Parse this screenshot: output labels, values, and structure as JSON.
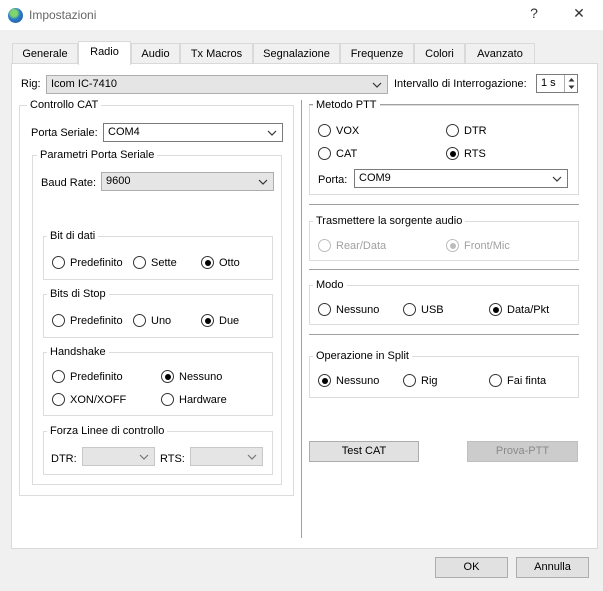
{
  "window": {
    "title": "Impostazioni",
    "help": "?",
    "close": "✕"
  },
  "tabs": [
    "Generale",
    "Radio",
    "Audio",
    "Tx Macros",
    "Segnalazione",
    "Frequenze",
    "Colori",
    "Avanzato"
  ],
  "rig": {
    "label": "Rig:",
    "value": "Icom IC-7410"
  },
  "polling": {
    "label": "Intervallo di Interrogazione:",
    "value": "1 s"
  },
  "cat": {
    "title": "Controllo CAT",
    "serial_port_label": "Porta Seriale:",
    "serial_port_value": "COM4",
    "params_title": "Parametri Porta Seriale",
    "baud_label": "Baud Rate:",
    "baud_value": "9600",
    "data_bits": {
      "title": "Bit di dati",
      "options": [
        "Predefinito",
        "Sette",
        "Otto"
      ]
    },
    "stop_bits": {
      "title": "Bits di Stop",
      "options": [
        "Predefinito",
        "Uno",
        "Due"
      ]
    },
    "handshake": {
      "title": "Handshake",
      "options": [
        "Predefinito",
        "Nessuno",
        "XON/XOFF",
        "Hardware"
      ]
    },
    "force_lines": {
      "title": "Forza Linee di controllo",
      "dtr_label": "DTR:",
      "rts_label": "RTS:"
    }
  },
  "ptt": {
    "title": "Metodo PTT",
    "options": [
      "VOX",
      "DTR",
      "CAT",
      "RTS"
    ],
    "port_label": "Porta:",
    "port_value": "COM9"
  },
  "audio_source": {
    "title": "Trasmettere la sorgente audio",
    "options": [
      "Rear/Data",
      "Front/Mic"
    ]
  },
  "mode": {
    "title": "Modo",
    "options": [
      "Nessuno",
      "USB",
      "Data/Pkt"
    ]
  },
  "split": {
    "title": "Operazione in Split",
    "options": [
      "Nessuno",
      "Rig",
      "Fai finta"
    ]
  },
  "buttons": {
    "test_cat": "Test CAT",
    "test_ptt": "Prova-PTT",
    "ok": "OK",
    "cancel": "Annulla"
  }
}
